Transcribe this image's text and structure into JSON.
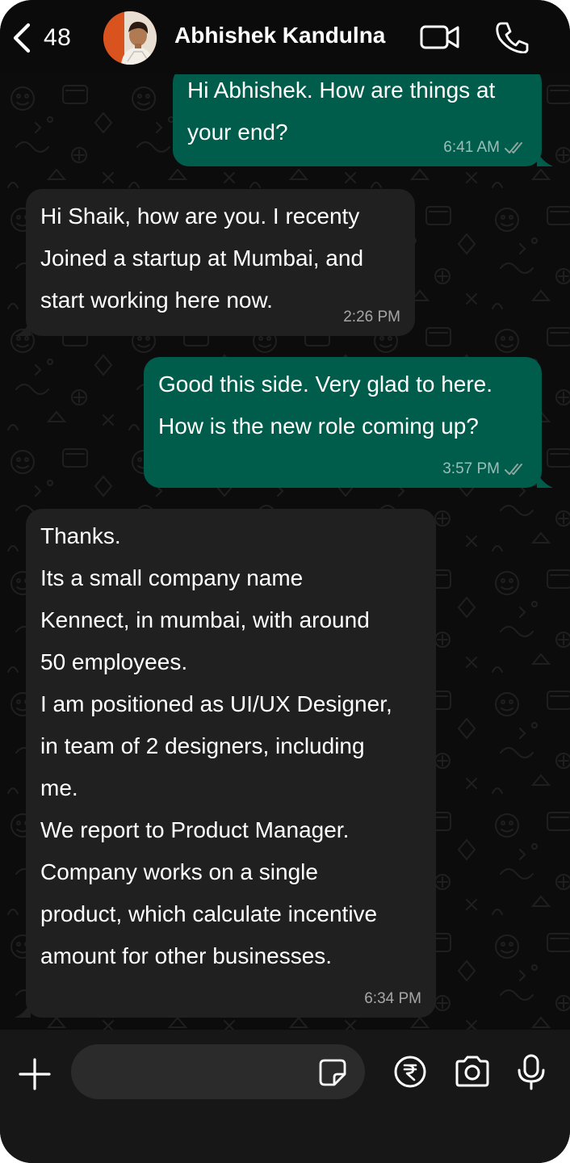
{
  "header": {
    "back_count": "48",
    "contact_name": "Abhishek Kandulna"
  },
  "messages": [
    {
      "direction": "outgoing",
      "lines": [
        "Hi Abhishek. How are things at",
        "your end?"
      ],
      "time": "6:41 AM",
      "status": "read"
    },
    {
      "direction": "incoming",
      "lines": [
        "Hi Shaik, how are you. I recenty",
        "Joined a startup at Mumbai, and",
        "start working here now."
      ],
      "time": "2:26 PM"
    },
    {
      "direction": "outgoing",
      "lines": [
        "Good this side. Very glad to here.",
        "How is the new role coming up?"
      ],
      "time": "3:57 PM",
      "status": "read"
    },
    {
      "direction": "incoming",
      "lines": [
        "Thanks.",
        "Its a small company name",
        "Kennect, in mumbai, with around",
        "50 employees.",
        "I am positioned as UI/UX Designer,",
        "in team of 2 designers, including",
        "me.",
        "We report to Product Manager.",
        "Company works on a single",
        "product, which calculate incentive",
        "amount for other businesses."
      ],
      "time": "6:34 PM"
    }
  ],
  "composer": {
    "input_value": "",
    "icons": [
      "plus-icon",
      "sticker-icon",
      "rupee-icon",
      "camera-icon",
      "microphone-icon"
    ]
  },
  "header_icons": [
    "back-chevron-icon",
    "video-call-icon",
    "phone-icon"
  ],
  "colors": {
    "outgoing_bubble": "#005c4b",
    "incoming_bubble": "#202020",
    "background": "#0b0b0b",
    "read_ticks": "#8fa6a0"
  }
}
